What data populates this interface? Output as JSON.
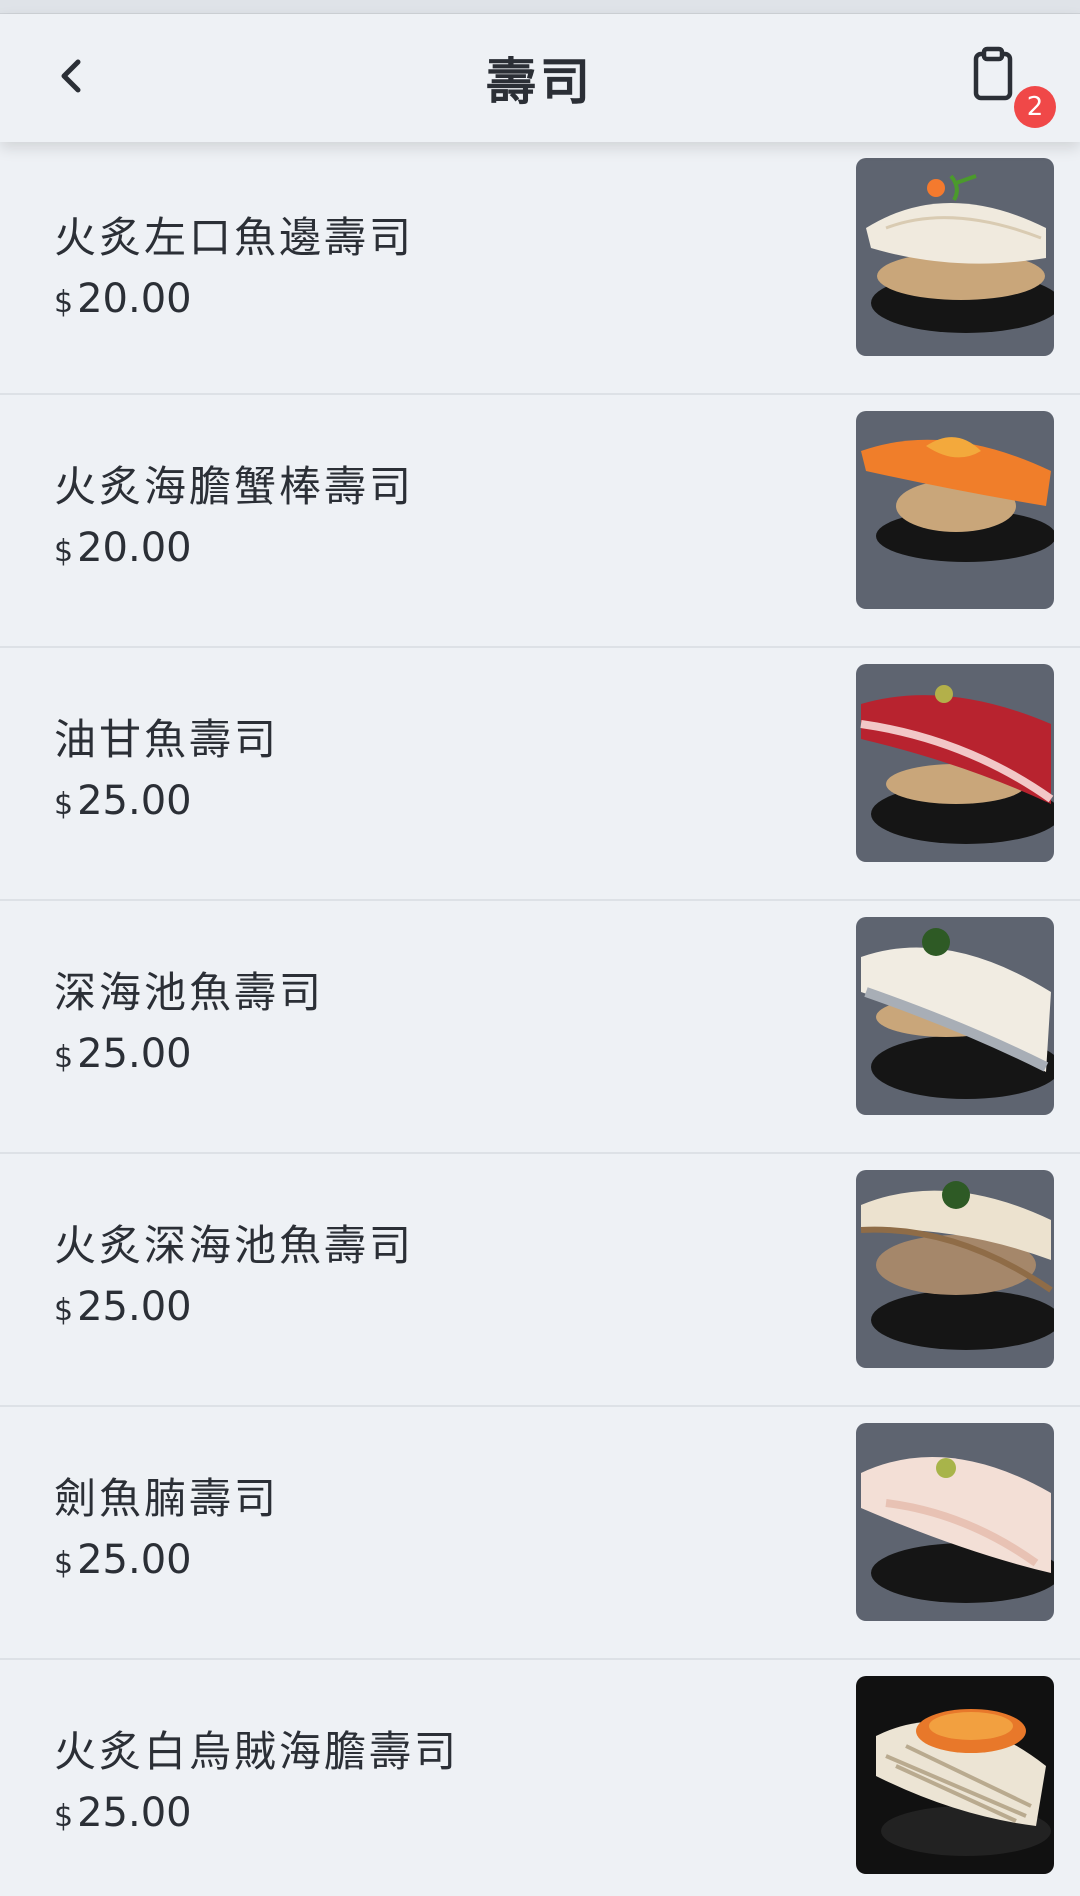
{
  "header": {
    "title": "壽司",
    "cart_count": "2"
  },
  "items": [
    {
      "name": "火炙左口魚邊壽司",
      "currency": "$",
      "price": "20.00"
    },
    {
      "name": "火炙海膽蟹棒壽司",
      "currency": "$",
      "price": "20.00"
    },
    {
      "name": "油甘魚壽司",
      "currency": "$",
      "price": "25.00"
    },
    {
      "name": "深海池魚壽司",
      "currency": "$",
      "price": "25.00"
    },
    {
      "name": "火炙深海池魚壽司",
      "currency": "$",
      "price": "25.00"
    },
    {
      "name": "劍魚腩壽司",
      "currency": "$",
      "price": "25.00"
    },
    {
      "name": "火炙白烏賊海膽壽司",
      "currency": "$",
      "price": "25.00"
    }
  ],
  "icons": {
    "back": "chevron-left-icon",
    "cart": "clipboard-icon"
  },
  "colors": {
    "background": "#eef1f5",
    "badge": "#f04848",
    "text": "#2b2f36"
  }
}
